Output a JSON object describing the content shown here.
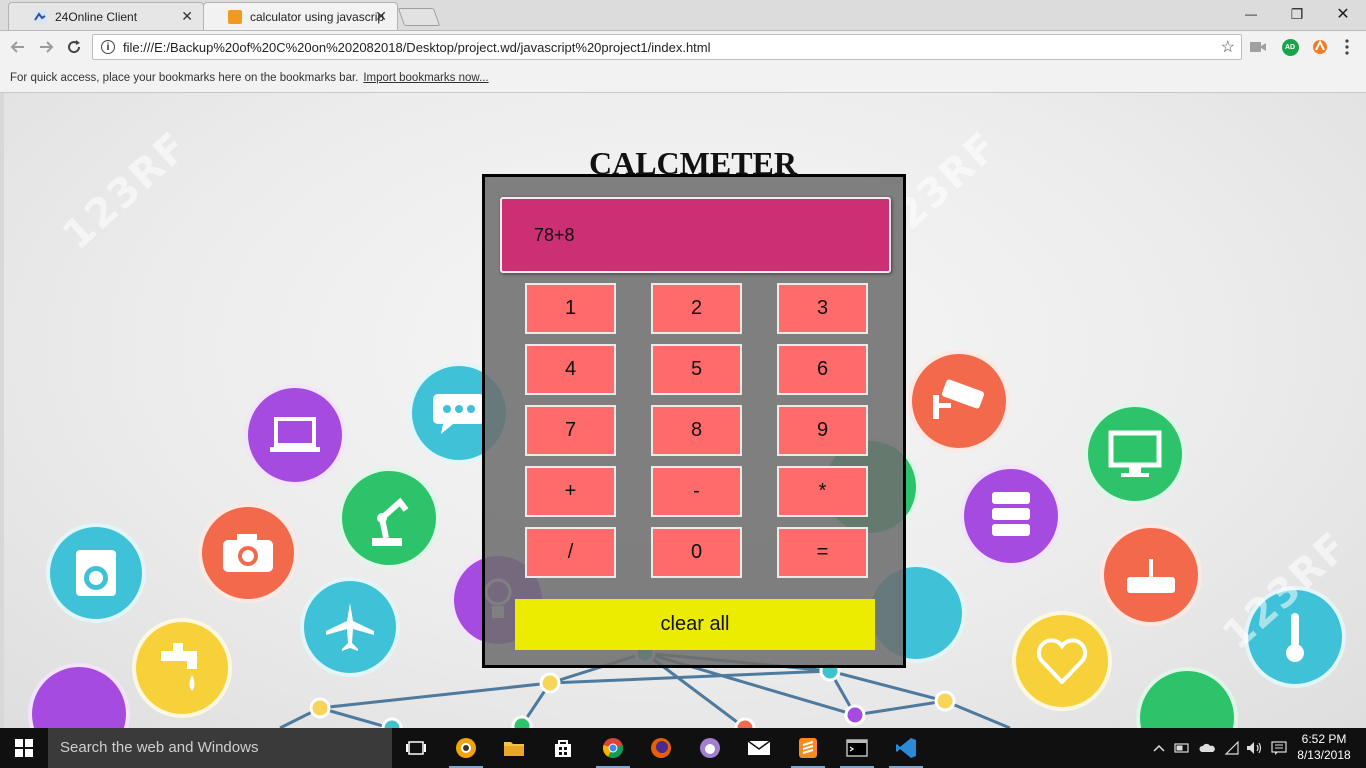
{
  "browser": {
    "tabs": [
      {
        "title": "24Online Client",
        "close": "✕"
      },
      {
        "title": "calculator using javascript",
        "close": "✕"
      }
    ],
    "window_controls": {
      "minimize": "—",
      "restore": "❐",
      "close": "✕"
    },
    "address": "file:///E:/Backup%20of%20C%20on%202082018/Desktop/project.wd/javascript%20project1/index.html",
    "extensions": {
      "adblock_label": "AD"
    },
    "bookmarks_bar": {
      "message": "For quick access, place your bookmarks here on the bookmarks bar.",
      "link": "Import bookmarks now..."
    }
  },
  "page": {
    "heading": "CALCMETER",
    "display": "78+8",
    "keys": [
      "1",
      "2",
      "3",
      "4",
      "5",
      "6",
      "7",
      "8",
      "9",
      "+",
      "-",
      "*",
      "/",
      "0",
      "="
    ],
    "clear_label": "clear all",
    "watermark": "123RF"
  },
  "taskbar": {
    "search_placeholder": "Search the web and Windows",
    "time": "6:52 PM",
    "date": "8/13/2018"
  },
  "colors": {
    "display_bg": "#cc2f74",
    "key_bg": "#ff6b6b",
    "clear_bg": "#ecec00",
    "calc_panel": "#6e6e6e"
  }
}
